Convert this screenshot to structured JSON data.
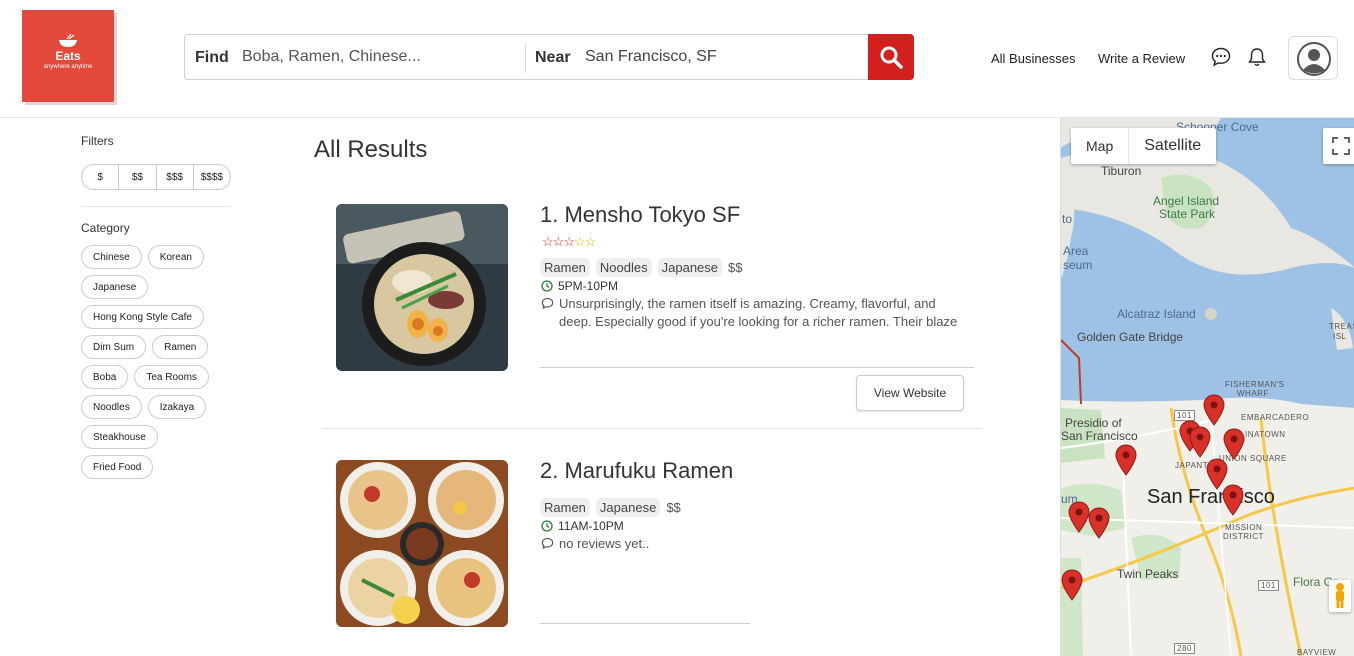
{
  "brand": {
    "name": "Eats",
    "tagline": "anywhere anytime",
    "color": "#e2493a"
  },
  "search": {
    "find_label": "Find",
    "find_placeholder": "Boba, Ramen, Chinese...",
    "near_label": "Near",
    "near_value": "San Francisco, SF",
    "button_icon": "search-icon",
    "button_color": "#d41f1f"
  },
  "nav": {
    "all_businesses": "All Businesses",
    "write_review": "Write a Review",
    "icons": [
      "chat-icon",
      "bell-icon",
      "user-avatar-icon"
    ]
  },
  "filters": {
    "title": "Filters",
    "prices": [
      "$",
      "$$",
      "$$$",
      "$$$$"
    ],
    "category_title": "Category",
    "categories": [
      "Chinese",
      "Korean",
      "Japanese",
      "Hong Kong Style Cafe",
      "Dim Sum",
      "Ramen",
      "Boba",
      "Tea Rooms",
      "Noodles",
      "Izakaya",
      "Steakhouse",
      "Fried Food"
    ]
  },
  "results": {
    "title": "All Results",
    "items": [
      {
        "name": "1. Mensho Tokyo SF",
        "rating": 3,
        "rating_max": 5,
        "tags": [
          "Ramen",
          "Noodles",
          "Japanese"
        ],
        "price": "$$",
        "hours": "5PM-10PM",
        "review": "Unsurprisingly, the ramen itself is amazing. Creamy, flavorful, and deep. Especially good if you're looking for a richer ramen. Their blaze ramen had a surprising punch of garlic which I loved. I tried their",
        "button": "View Website"
      },
      {
        "name": "2. Marufuku Ramen",
        "tags": [
          "Ramen",
          "Japanese"
        ],
        "price": "$$",
        "hours": "11AM-10PM",
        "review": "no reviews yet.."
      }
    ]
  },
  "map": {
    "toggle": [
      "Map",
      "Satellite"
    ],
    "labels": {
      "schoonerCove": "Schooner Cove",
      "tiburon": "Tiburon",
      "angelIsland1": "Angel Island",
      "angelIsland2": "State Park",
      "to": "to",
      "area": "Area",
      "seum": "seum",
      "alcatraz": "Alcatraz Island",
      "treas": "TREAS",
      "isl": "ISL",
      "goldenGate": "Golden Gate Bridge",
      "fishermans1": "FISHERMAN'S",
      "fishermans2": "WHARF",
      "embarcadero": "EMBARCADERO",
      "presidio1": "Presidio of",
      "presidio2": "San Francisco",
      "chinatown": "INATOWN",
      "unionSquare": "UNION SQUARE",
      "japantown": "JAPANTO",
      "sanFrancisco": "San Francisco",
      "um": "um",
      "mission1": "MISSION",
      "mission2": "DISTRICT",
      "twinPeaks": "Twin Peaks",
      "floraGr": "Flora Gr",
      "bayview": "BAYVIEW",
      "hwy101a": "101",
      "hwy101b": "101",
      "hwy280": "280"
    },
    "pin_color": "#d9302a",
    "marker_count": 10
  }
}
